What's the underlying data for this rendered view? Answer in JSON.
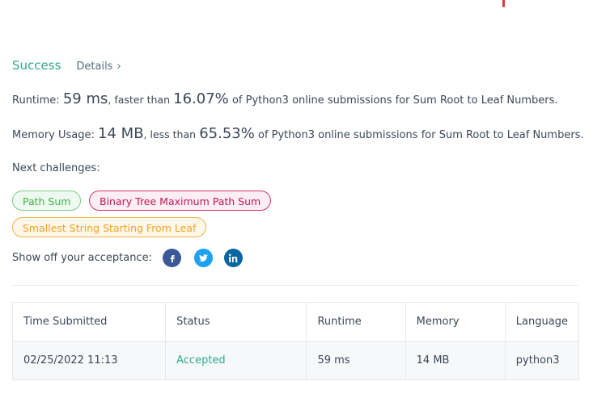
{
  "status": {
    "title": "Success",
    "details_label": "Details",
    "details_chevron": "›"
  },
  "runtime": {
    "label": "Runtime:",
    "value": "59 ms",
    "mid_text": ", faster than",
    "percent": "16.07%",
    "suffix": "of Python3 online submissions for Sum Root to Leaf Numbers."
  },
  "memory": {
    "label": "Memory Usage:",
    "value": "14 MB",
    "mid_text": ", less than",
    "percent": "65.53%",
    "suffix": "of Python3 online submissions for Sum Root to Leaf Numbers."
  },
  "next_challenges": {
    "label": "Next challenges:",
    "items": [
      {
        "label": "Path Sum",
        "color": "#4caf50"
      },
      {
        "label": "Binary Tree Maximum Path Sum",
        "color": "#c2185b"
      },
      {
        "label": "Smallest String Starting From Leaf",
        "color": "#f0a226"
      }
    ]
  },
  "share": {
    "label": "Show off your acceptance:",
    "icons": [
      "facebook-icon",
      "twitter-icon",
      "linkedin-icon"
    ]
  },
  "table": {
    "headers": [
      "Time Submitted",
      "Status",
      "Runtime",
      "Memory",
      "Language"
    ],
    "rows": [
      {
        "time": "02/25/2022 11:13",
        "status": "Accepted",
        "runtime": "59 ms",
        "memory": "14 MB",
        "language": "python3"
      }
    ]
  },
  "colors": {
    "accent": "#2eab8e",
    "facebook": "#3b5998",
    "twitter": "#1da1f2",
    "linkedin": "#0a66a0"
  }
}
